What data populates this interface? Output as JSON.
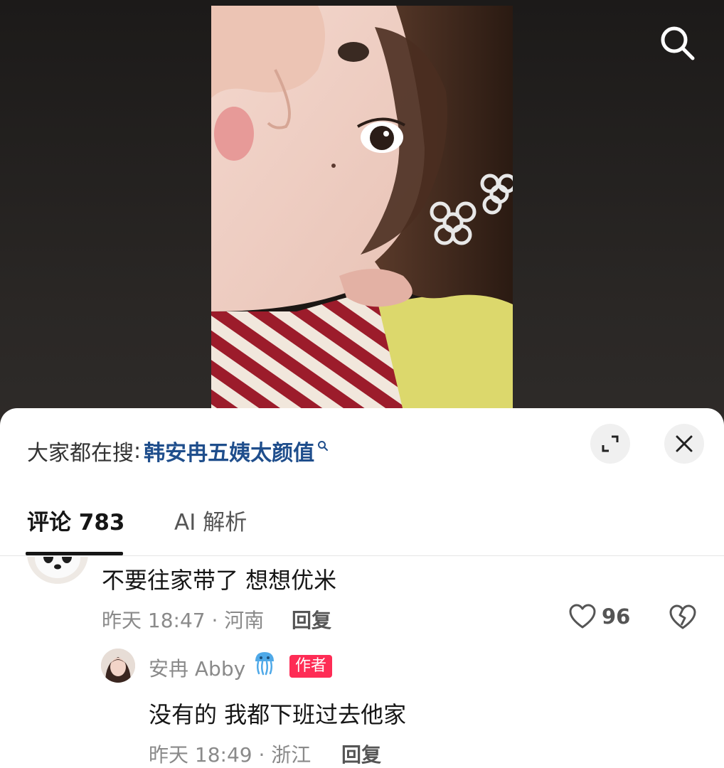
{
  "search_button": {
    "icon": "search-icon"
  },
  "hot_search": {
    "prefix": "大家都在搜",
    "colon": ":",
    "term": "韩安冉五姨太颜值",
    "term_color": "#1f4e8c",
    "icon": "search-icon"
  },
  "sheet_controls": {
    "expand_icon": "expand-icon",
    "close_icon": "close-icon"
  },
  "tabs": [
    {
      "label": "评论 783",
      "active": true
    },
    {
      "label": "AI 解析",
      "active": false
    }
  ],
  "comment": {
    "avatar": "panda-avatar",
    "text": "不要往家带了 想想优米",
    "meta": "昨天 18:47 · 河南",
    "reply_label": "回复",
    "like_icon": "heart-icon",
    "like_count": "96",
    "dislike_icon": "broken-heart-icon"
  },
  "reply": {
    "author_name": "安冉 Abby",
    "author_emoji": "jellyfish-icon",
    "badge": "作者",
    "badge_color": "#fe2c55",
    "text": "没有的 我都下班过去他家",
    "meta": "昨天 18:49 · 浙江",
    "reply_label": "回复"
  }
}
